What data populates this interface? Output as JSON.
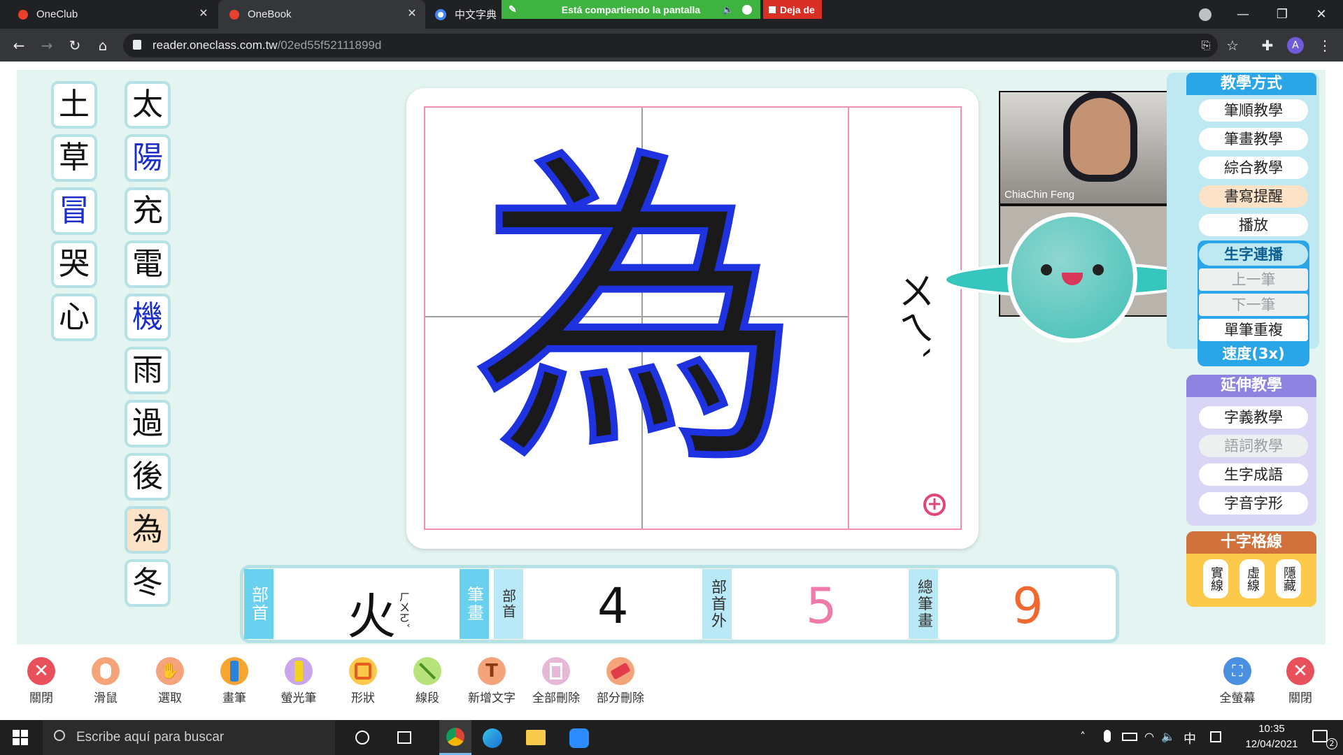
{
  "browser": {
    "tabs": [
      {
        "title": "OneClub"
      },
      {
        "title": "OneBook"
      },
      {
        "title": "中文字典"
      }
    ],
    "share_banner": "Está compartiendo la pantalla",
    "share_stop": "Deja de",
    "url_host": "reader.oneclass.com.tw",
    "url_path": "/02ed55f52111899d",
    "profile_initial": "A"
  },
  "characters_left": [
    "土",
    "草",
    "冒",
    "哭",
    "心"
  ],
  "characters_right": [
    "太",
    "陽",
    "充",
    "電",
    "機",
    "雨",
    "過",
    "後",
    "為",
    "冬"
  ],
  "main_character": "為",
  "zhuyin": "ㄨㄟˋ",
  "video": {
    "participant_name": "ChiaChin Feng"
  },
  "panel_teaching": {
    "title": "教學方式",
    "items": [
      "筆順教學",
      "筆畫教學",
      "綜合教學",
      "書寫提醒",
      "播放"
    ]
  },
  "panel_playback": {
    "title": "生字連播",
    "items": [
      "上一筆",
      "下一筆",
      "單筆重複"
    ],
    "speed": "速度(3x)"
  },
  "panel_extend": {
    "title": "延伸教學",
    "items": [
      "字義教學",
      "語詞教學",
      "生字成語",
      "字音字形"
    ]
  },
  "panel_grid": {
    "title": "十字格線",
    "options": [
      "實線",
      "虛線",
      "隱藏"
    ]
  },
  "info": {
    "radical_label": "部首",
    "radical_value": "火",
    "radical_zhuyin": "ㄏㄨㄛˇ",
    "radical_strokes_label": "筆畫",
    "radical_strokes_sublabel": "部首",
    "radical_strokes_value": "4",
    "other_strokes_label": "部首外",
    "other_strokes_value": "5",
    "total_strokes_label": "總筆畫",
    "total_strokes_value": "9"
  },
  "toolbar": {
    "tools": [
      "關閉",
      "滑鼠",
      "選取",
      "畫筆",
      "螢光筆",
      "形狀",
      "線段",
      "新增文字",
      "全部刪除",
      "部分刪除"
    ],
    "fullscreen": "全螢幕",
    "close_right": "關閉"
  },
  "taskbar": {
    "search_placeholder": "Escribe aquí para buscar",
    "time": "10:35",
    "date": "12/04/2021",
    "ime": "中",
    "notifications": "2"
  }
}
